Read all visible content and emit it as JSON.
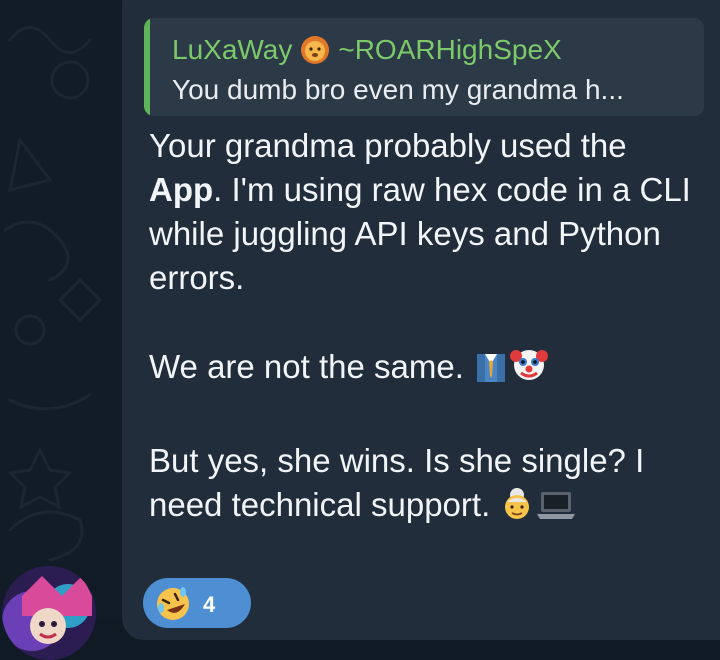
{
  "reply": {
    "author": "LuXaWay",
    "author_suffix": "~ROARHighSpeX",
    "author_icon": "lion-face-icon",
    "text": "You dumb bro even my grandma h..."
  },
  "message": {
    "para1_pre": "Your grandma probably used the ",
    "para1_bold": "App",
    "para1_post": ". I'm using raw hex code in a CLI while juggling API keys and Python errors.",
    "para2": "We are not the same.",
    "para2_icons": [
      "man-in-suit-icon",
      "clown-face-icon"
    ],
    "para3": "But yes, she wins. Is she single? I need technical support.",
    "para3_icons": [
      "old-woman-icon",
      "laptop-icon"
    ]
  },
  "reaction": {
    "icon": "rolling-on-floor-laughing-icon",
    "count": "4"
  },
  "colors": {
    "bubble": "#212d3b",
    "reply_bar": "#5fb35a",
    "reply_author": "#7cc96a",
    "reaction_bg": "#4e8fd3"
  }
}
